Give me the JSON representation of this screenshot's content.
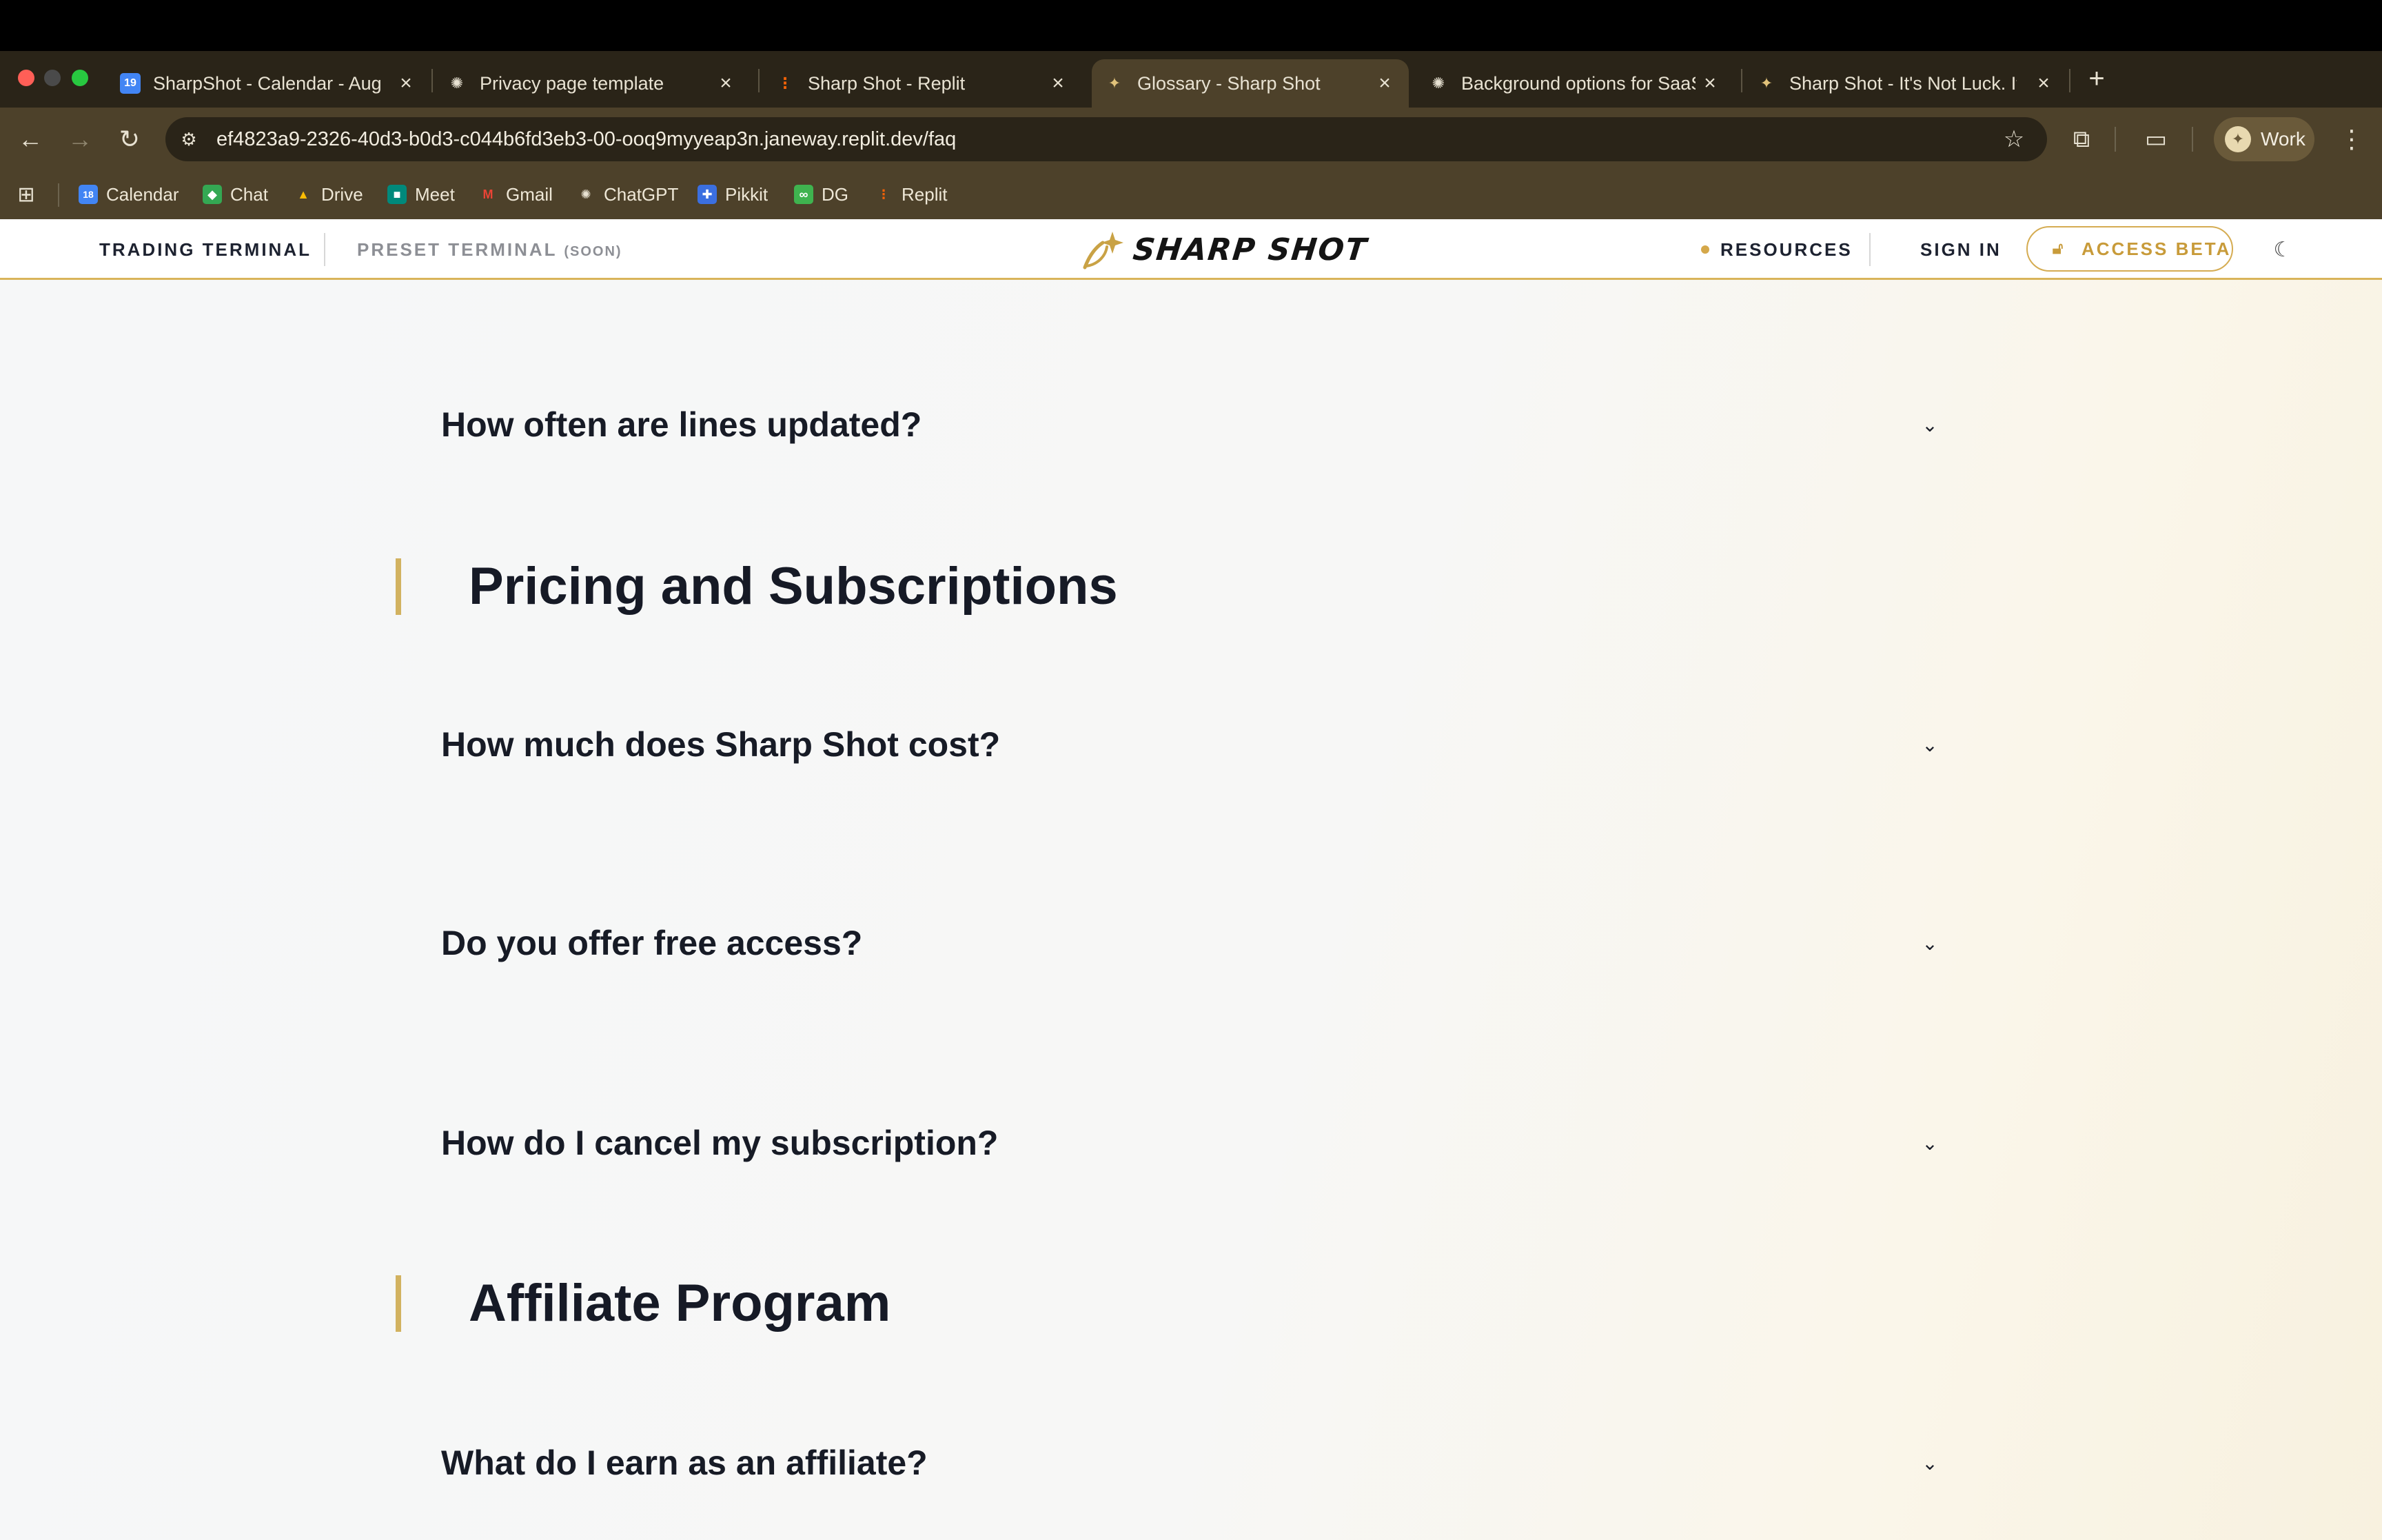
{
  "browser": {
    "tabs": [
      {
        "label": "SharpShot - Calendar - Augu",
        "icon": "calendar-icon"
      },
      {
        "label": "Privacy page template",
        "icon": "chatgpt-icon"
      },
      {
        "label": "Sharp Shot - Replit",
        "icon": "replit-icon"
      },
      {
        "label": "Glossary - Sharp Shot",
        "icon": "sharpshot-icon",
        "active": true
      },
      {
        "label": "Background options for SaaS",
        "icon": "chatgpt-icon"
      },
      {
        "label": "Sharp Shot - It's Not Luck. It'",
        "icon": "sharpshot-icon"
      }
    ],
    "close_glyph": "×",
    "newtab_glyph": "+",
    "url": "ef4823a9-2326-40d3-b0d3-c044b6fd3eb3-00-ooq9myyeap3n.janeway.replit.dev/faq",
    "profile_label": "Work",
    "bookmarks": [
      {
        "label": "Calendar",
        "icon": "calendar-icon",
        "color": "#4285f4",
        "glyph": "18"
      },
      {
        "label": "Chat",
        "icon": "chat-icon",
        "color": "#34a853",
        "glyph": "◆"
      },
      {
        "label": "Drive",
        "icon": "drive-icon",
        "color": "#fbbc04",
        "glyph": "▲"
      },
      {
        "label": "Meet",
        "icon": "meet-icon",
        "color": "#00897b",
        "glyph": "■"
      },
      {
        "label": "Gmail",
        "icon": "gmail-icon",
        "color": "#ea4335",
        "glyph": "M"
      },
      {
        "label": "ChatGPT",
        "icon": "chatgpt-icon",
        "color": "#5a5a5a",
        "glyph": "✺"
      },
      {
        "label": "Pikkit",
        "icon": "pikkit-icon",
        "color": "#3b6fe0",
        "glyph": "✚"
      },
      {
        "label": "DG",
        "icon": "dg-icon",
        "color": "#3fb34f",
        "glyph": "∞"
      },
      {
        "label": "Replit",
        "icon": "replit-icon",
        "color": "#f26207",
        "glyph": "⋮"
      }
    ]
  },
  "site": {
    "nav": {
      "trading_terminal": "TRADING TERMINAL",
      "preset_terminal": "PRESET TERMINAL",
      "soon": "(SOON)",
      "logo_text": "SHARP SHOT",
      "resources": "RESOURCES",
      "sign_in": "SIGN IN",
      "access_beta": "ACCESS BETA"
    },
    "colors": {
      "accent": "#d5ac52",
      "heading": "#161a26"
    }
  },
  "faq": {
    "q_lines_updated": "How often are lines updated?",
    "pricing": {
      "title": "Pricing and Subscriptions",
      "questions": [
        "How much does Sharp Shot cost?",
        "Do you offer free access?",
        "How do I cancel my subscription?"
      ]
    },
    "affiliate": {
      "title": "Affiliate Program",
      "questions": [
        "What do I earn as an affiliate?"
      ]
    }
  }
}
